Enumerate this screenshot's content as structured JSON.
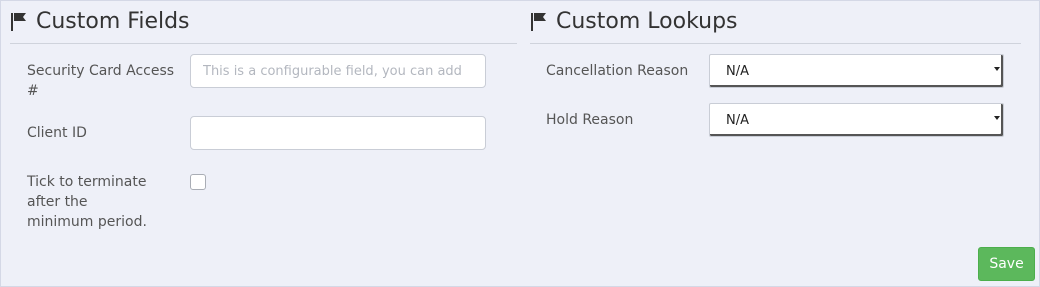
{
  "custom_fields": {
    "title": "Custom Fields",
    "icon": "flag-icon",
    "fields": [
      {
        "label": "Security Card Access #",
        "type": "text",
        "value": "",
        "placeholder": "This is a configurable field, you can add"
      },
      {
        "label": "Client ID",
        "type": "text",
        "value": "",
        "placeholder": ""
      },
      {
        "label": "Tick to terminate after the minimum period.",
        "type": "checkbox",
        "checked": false
      }
    ]
  },
  "custom_lookups": {
    "title": "Custom Lookups",
    "icon": "flag-icon",
    "fields": [
      {
        "label": "Cancellation Reason",
        "type": "select",
        "selected": "N/A"
      },
      {
        "label": "Hold Reason",
        "type": "select",
        "selected": "N/A"
      }
    ]
  },
  "actions": {
    "save_label": "Save",
    "save_color": "#5cb85c"
  }
}
